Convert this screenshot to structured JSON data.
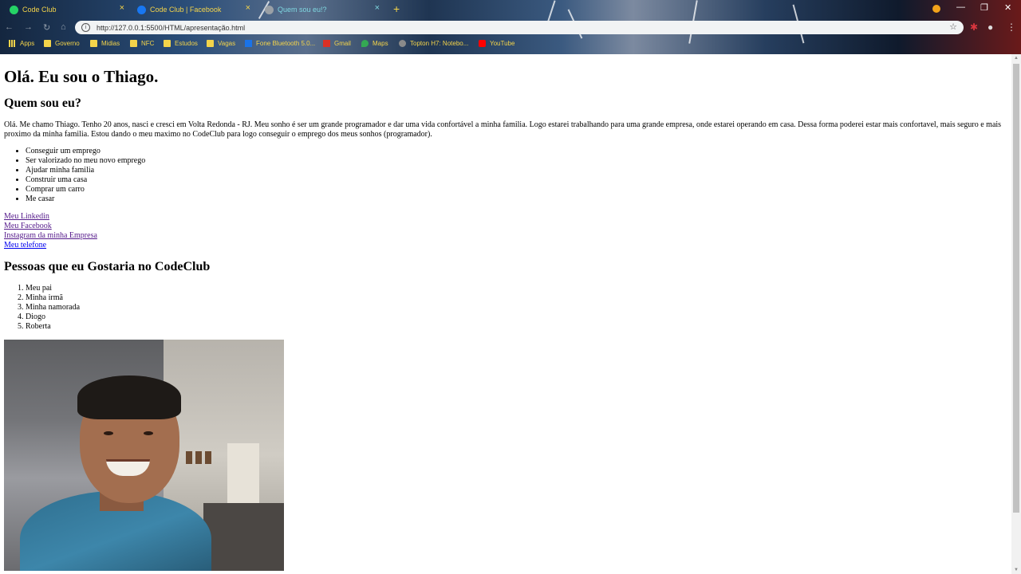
{
  "browser": {
    "tabs": [
      {
        "title": "Code Club",
        "icon": "whatsapp-icon",
        "color": "#25d366"
      },
      {
        "title": "Code Club | Facebook",
        "icon": "facebook-icon",
        "color": "#1877f2"
      },
      {
        "title": "Quem sou eu!?",
        "icon": "globe-icon",
        "color": "#9aa0a6"
      }
    ],
    "url": "http://127.0.0.1:5500/HTML/apresentação.html",
    "bookmarks": [
      {
        "label": "Apps",
        "icon": "apps-grid-icon"
      },
      {
        "label": "Governo",
        "icon": "folder-icon"
      },
      {
        "label": "Midias",
        "icon": "folder-icon"
      },
      {
        "label": "NFC",
        "icon": "folder-icon"
      },
      {
        "label": "Estudos",
        "icon": "folder-icon"
      },
      {
        "label": "Vagas",
        "icon": "folder-icon"
      },
      {
        "label": "Fone Bluetooth 5.0...",
        "icon": "e-icon"
      },
      {
        "label": "Gmail",
        "icon": "gmail-icon"
      },
      {
        "label": "Maps",
        "icon": "maps-icon"
      },
      {
        "label": "Topton H7: Notebo...",
        "icon": "globe-icon"
      },
      {
        "label": "YouTube",
        "icon": "youtube-icon"
      }
    ]
  },
  "page": {
    "title": "Olá. Eu sou o Thiago.",
    "about_heading": "Quem sou eu?",
    "about_text": "Olá. Me chamo Thiago. Tenho 20 anos, nasci e cresci em Volta Redonda - RJ. Meu sonho é ser um grande programador e dar uma vida confortável a minha familia. Logo estarei trabalhando para uma grande empresa, onde estarei operando em casa. Dessa forma poderei estar mais confortavel, mais seguro e mais proximo da minha familia. Estou dando o meu maximo no CodeClub para logo conseguir o emprego dos meus sonhos (programador).",
    "goals": [
      "Conseguir um emprego",
      "Ser valorizado no meu novo emprego",
      "Ajudar minha familia",
      "Construir uma casa",
      "Comprar um carro",
      "Me casar"
    ],
    "links": [
      {
        "label": "Meu Linkedin",
        "visited": true
      },
      {
        "label": "Meu Facebook",
        "visited": true
      },
      {
        "label": "Instagram da minha Empresa",
        "visited": true
      },
      {
        "label": "Meu telefone",
        "visited": false
      }
    ],
    "people_heading": "Pessoas que eu Gostaria no CodeClub",
    "people": [
      "Meu pai",
      "Minha irmã",
      "Minha namorada",
      "Diogo",
      "Roberta"
    ]
  }
}
